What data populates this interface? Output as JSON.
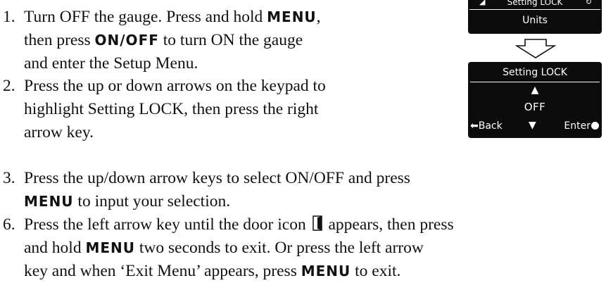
{
  "steps": [
    {
      "number": "1.",
      "lines": [
        [
          "Turn OFF the gauge. Press and hold ",
          {
            "kw": "MENU"
          },
          ","
        ],
        [
          "then press ",
          {
            "kw": "ON/OFF"
          },
          " to turn ON the gauge"
        ],
        [
          "and enter the Setup Menu."
        ]
      ]
    },
    {
      "number": "2.",
      "lines": [
        [
          "Press the up or down arrows on the keypad to"
        ],
        [
          "highlight Setting LOCK, then press the right"
        ],
        [
          "arrow key."
        ]
      ]
    },
    {
      "number": "3.",
      "lines": [
        [
          "Press the up/down arrow keys to select ON/OFF and press"
        ],
        [
          {
            "kw": "MENU"
          },
          " to input your selection."
        ]
      ]
    },
    {
      "number": "6.",
      "lines": [
        [
          "Press the left arrow key until the door icon ",
          {
            "icon": "door-icon"
          },
          " appears, then press"
        ],
        [
          "and hold ",
          {
            "kw": "MENU"
          },
          " two seconds to exit. Or press the left arrow"
        ],
        [
          "key and when ‘Exit Menu’ appears, press ",
          {
            "kw": "MENU"
          },
          " to exit."
        ]
      ]
    }
  ],
  "screen_top": {
    "title": "Setting LOCK",
    "item": "Units"
  },
  "screen_main": {
    "title": "Setting LOCK",
    "up_symbol": "▲",
    "value": "OFF",
    "down_symbol": "▼",
    "back_label": "Back",
    "enter_label": "Enter"
  },
  "colors": {
    "text": "#111111",
    "screen_bg": "#0c0c0c",
    "screen_text": "#ffffff"
  }
}
